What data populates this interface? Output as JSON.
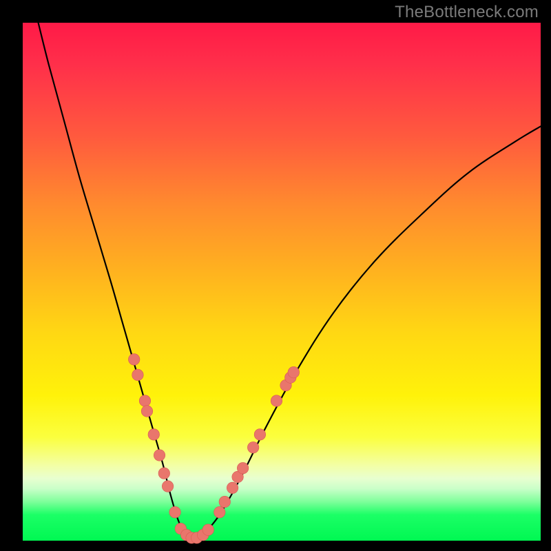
{
  "watermark": "TheBottleneck.com",
  "colors": {
    "frame": "#000000",
    "curve_stroke": "#000000",
    "dot_fill": "#e9766c",
    "dot_stroke": "#d85b52"
  },
  "chart_data": {
    "type": "line",
    "title": "",
    "xlabel": "",
    "ylabel": "",
    "xlim": [
      0,
      100
    ],
    "ylim": [
      0,
      100
    ],
    "series": [
      {
        "name": "bottleneck-curve",
        "x": [
          3,
          5,
          8,
          11,
          14,
          17,
          19,
          21,
          23,
          25,
          27,
          28.5,
          30,
          31.5,
          33,
          35,
          38,
          42,
          47,
          53,
          60,
          68,
          77,
          86,
          95,
          100
        ],
        "y": [
          100,
          92,
          81,
          70,
          60,
          50,
          43,
          36,
          29,
          22,
          15,
          9,
          4,
          1,
          0.4,
          1.5,
          5,
          12,
          22,
          33,
          44,
          54,
          63,
          71,
          77,
          80
        ]
      }
    ],
    "markers": [
      {
        "series": "left-dots",
        "x": 21.5,
        "y": 35
      },
      {
        "series": "left-dots",
        "x": 22.2,
        "y": 32
      },
      {
        "series": "left-dots",
        "x": 23.6,
        "y": 27
      },
      {
        "series": "left-dots",
        "x": 24.0,
        "y": 25
      },
      {
        "series": "left-dots",
        "x": 25.3,
        "y": 20.5
      },
      {
        "series": "left-dots",
        "x": 26.4,
        "y": 16.5
      },
      {
        "series": "left-dots",
        "x": 27.3,
        "y": 13
      },
      {
        "series": "left-dots",
        "x": 28.0,
        "y": 10.5
      },
      {
        "series": "left-dots",
        "x": 29.4,
        "y": 5.5
      },
      {
        "series": "bottom-dots",
        "x": 30.5,
        "y": 2.3
      },
      {
        "series": "bottom-dots",
        "x": 31.6,
        "y": 1.1
      },
      {
        "series": "bottom-dots",
        "x": 32.6,
        "y": 0.55
      },
      {
        "series": "bottom-dots",
        "x": 33.6,
        "y": 0.55
      },
      {
        "series": "bottom-dots",
        "x": 34.8,
        "y": 1.1
      },
      {
        "series": "bottom-dots",
        "x": 35.8,
        "y": 2.1
      },
      {
        "series": "right-dots",
        "x": 38.0,
        "y": 5.5
      },
      {
        "series": "right-dots",
        "x": 39.0,
        "y": 7.5
      },
      {
        "series": "right-dots",
        "x": 40.5,
        "y": 10.2
      },
      {
        "series": "right-dots",
        "x": 41.5,
        "y": 12.3
      },
      {
        "series": "right-dots",
        "x": 42.5,
        "y": 14
      },
      {
        "series": "right-dots",
        "x": 44.5,
        "y": 18
      },
      {
        "series": "right-dots",
        "x": 45.8,
        "y": 20.5
      },
      {
        "series": "right-dots",
        "x": 49.0,
        "y": 27
      },
      {
        "series": "right-dots",
        "x": 50.8,
        "y": 30
      },
      {
        "series": "right-dots",
        "x": 51.7,
        "y": 31.5
      },
      {
        "series": "right-dots",
        "x": 52.3,
        "y": 32.5
      }
    ],
    "marker_radius_pct": 1.1
  }
}
